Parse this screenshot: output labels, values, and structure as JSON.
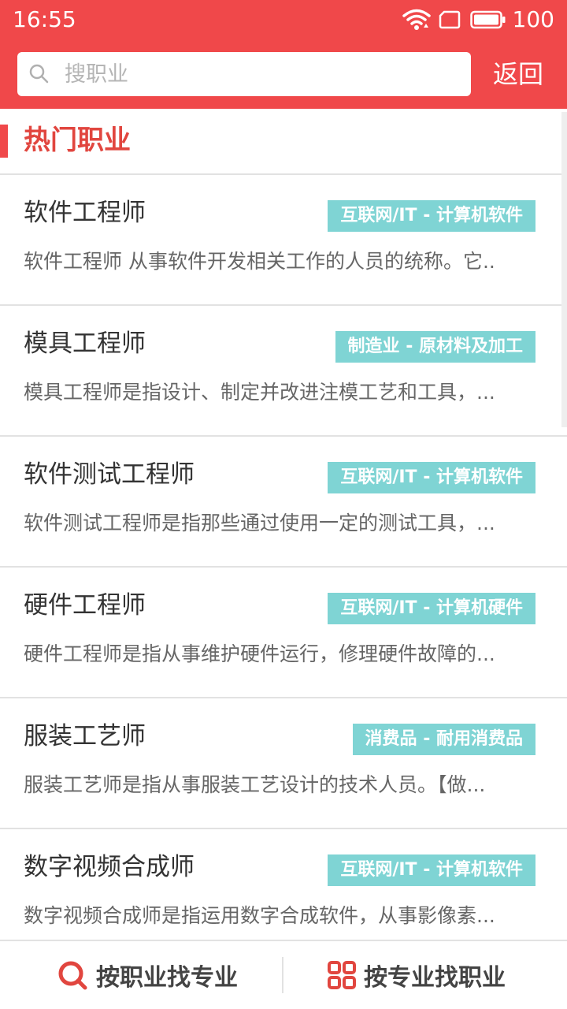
{
  "status_bar": {
    "time": "16:55",
    "battery": "100"
  },
  "search": {
    "placeholder": "搜职业"
  },
  "header": {
    "back_label": "返回"
  },
  "section": {
    "title": "热门职业"
  },
  "careers": [
    {
      "name": "软件工程师",
      "tag": "互联网/IT - 计算机软件",
      "desc": "软件工程师 从事软件开发相关工作的人员的统称。它.."
    },
    {
      "name": "模具工程师",
      "tag": "制造业 - 原材料及加工",
      "desc": "模具工程师是指设计、制定并改进注模工艺和工具，..."
    },
    {
      "name": "软件测试工程师",
      "tag": "互联网/IT - 计算机软件",
      "desc": "软件测试工程师是指那些通过使用一定的测试工具，..."
    },
    {
      "name": "硬件工程师",
      "tag": "互联网/IT - 计算机硬件",
      "desc": "硬件工程师是指从事维护硬件运行，修理硬件故障的..."
    },
    {
      "name": "服装工艺师",
      "tag": "消费品 - 耐用消费品",
      "desc": "服装工艺师是指从事服装工艺设计的技术人员。【做..."
    },
    {
      "name": "数字视频合成师",
      "tag": "互联网/IT - 计算机软件",
      "desc": "数字视频合成师是指运用数字合成软件，从事影像素..."
    }
  ],
  "bottom_nav": {
    "left_label": "按职业找专业",
    "right_label": "按专业找职业"
  },
  "colors": {
    "brand": "#f0484a",
    "tag_bg": "#7fd4d4"
  }
}
